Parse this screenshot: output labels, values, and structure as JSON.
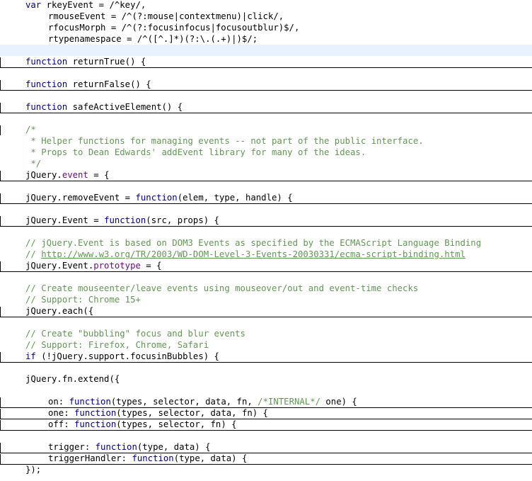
{
  "editor": {
    "language": "JavaScript",
    "lines": [
      {
        "indent": 0,
        "segments": [
          {
            "c": "kw",
            "t": "var "
          },
          {
            "c": "str",
            "t": "rkeyEvent = /^key/,"
          }
        ]
      },
      {
        "indent": 1,
        "segments": [
          {
            "c": "str",
            "t": "rmouseEvent = /^(?:mouse|contextmenu)|click/,"
          }
        ]
      },
      {
        "indent": 1,
        "segments": [
          {
            "c": "str",
            "t": "rfocusMorph = /^(?:focusinfocus|focusoutblur)$/,"
          }
        ]
      },
      {
        "indent": 1,
        "segments": [
          {
            "c": "str",
            "t": "rtypenamespace = /^([^.]*)(?:\\.(.+)|)$/;"
          }
        ]
      },
      {
        "indent": 0,
        "segments": [],
        "current": true
      },
      {
        "indent": 0,
        "fold": true,
        "separator": true,
        "segments": [
          {
            "c": "kw",
            "t": "function "
          },
          {
            "c": "plain",
            "t": "returnTrue() {"
          }
        ]
      },
      {
        "indent": 0,
        "segments": []
      },
      {
        "indent": 0,
        "fold": true,
        "separator": true,
        "segments": [
          {
            "c": "kw",
            "t": "function "
          },
          {
            "c": "plain",
            "t": "returnFalse() {"
          }
        ]
      },
      {
        "indent": 0,
        "segments": []
      },
      {
        "indent": 0,
        "fold": true,
        "separator": true,
        "segments": [
          {
            "c": "kw",
            "t": "function "
          },
          {
            "c": "plain",
            "t": "safeActiveElement() {"
          }
        ]
      },
      {
        "indent": 0,
        "segments": []
      },
      {
        "indent": 0,
        "fold": true,
        "segments": [
          {
            "c": "dc",
            "t": "/*"
          }
        ]
      },
      {
        "indent": 0,
        "segments": [
          {
            "c": "dc",
            "t": " * Helper functions for managing events -- not part of the public interface."
          }
        ]
      },
      {
        "indent": 0,
        "segments": [
          {
            "c": "dc",
            "t": " * Props to Dean Edwards' addEvent library for many of the ideas."
          }
        ]
      },
      {
        "indent": 0,
        "segments": [
          {
            "c": "dc",
            "t": " */"
          }
        ]
      },
      {
        "indent": 0,
        "fold": true,
        "separator": true,
        "segments": [
          {
            "c": "plain",
            "t": "jQuery."
          },
          {
            "c": "fld",
            "t": "event"
          },
          {
            "c": "plain",
            "t": " = {"
          }
        ]
      },
      {
        "indent": 0,
        "segments": []
      },
      {
        "indent": 0,
        "fold": true,
        "separator": true,
        "segments": [
          {
            "c": "plain",
            "t": "jQuery.removeEvent = "
          },
          {
            "c": "kw",
            "t": "function"
          },
          {
            "c": "plain",
            "t": "(elem, type, handle) {"
          }
        ]
      },
      {
        "indent": 0,
        "segments": []
      },
      {
        "indent": 0,
        "fold": true,
        "separator": true,
        "segments": [
          {
            "c": "plain",
            "t": "jQuery.Event = "
          },
          {
            "c": "kw",
            "t": "function"
          },
          {
            "c": "plain",
            "t": "(src, props) {"
          }
        ]
      },
      {
        "indent": 0,
        "segments": []
      },
      {
        "indent": 0,
        "segments": [
          {
            "c": "dc",
            "t": "// jQuery.Event is based on DOM3 Events as specified by the ECMAScript Language Binding"
          }
        ]
      },
      {
        "indent": 0,
        "segments": [
          {
            "c": "dc",
            "t": "// "
          },
          {
            "c": "ln",
            "t": "http://www.w3.org/TR/2003/WD-DOM-Level-3-Events-20030331/ecma-script-binding.html"
          }
        ]
      },
      {
        "indent": 0,
        "fold": true,
        "separator": true,
        "segments": [
          {
            "c": "plain",
            "t": "jQuery.Event."
          },
          {
            "c": "fld",
            "t": "prototype"
          },
          {
            "c": "plain",
            "t": " = {"
          }
        ]
      },
      {
        "indent": 0,
        "segments": []
      },
      {
        "indent": 0,
        "segments": [
          {
            "c": "dc",
            "t": "// Create mouseenter/leave events using mouseover/out and event-time checks"
          }
        ]
      },
      {
        "indent": 0,
        "segments": [
          {
            "c": "dc",
            "t": "// Support: Chrome 15+"
          }
        ]
      },
      {
        "indent": 0,
        "fold": true,
        "separator": true,
        "segments": [
          {
            "c": "plain",
            "t": "jQuery.each({"
          }
        ]
      },
      {
        "indent": 0,
        "segments": []
      },
      {
        "indent": 0,
        "segments": [
          {
            "c": "dc",
            "t": "// Create \"bubbling\" focus and blur events"
          }
        ]
      },
      {
        "indent": 0,
        "segments": [
          {
            "c": "dc",
            "t": "// Support: Firefox, Chrome, Safari"
          }
        ]
      },
      {
        "indent": 0,
        "fold": true,
        "separator": true,
        "segments": [
          {
            "c": "kw",
            "t": "if"
          },
          {
            "c": "plain",
            "t": " (!jQuery.support.focusinBubbles) {"
          }
        ]
      },
      {
        "indent": 0,
        "segments": []
      },
      {
        "indent": 0,
        "segments": [
          {
            "c": "plain",
            "t": "jQuery.fn.extend({"
          }
        ]
      },
      {
        "indent": 0,
        "segments": []
      },
      {
        "indent": 1,
        "fold": true,
        "separator": true,
        "segments": [
          {
            "c": "plain",
            "t": "on: "
          },
          {
            "c": "kw",
            "t": "function"
          },
          {
            "c": "plain",
            "t": "(types, selector, data, fn, "
          },
          {
            "c": "dc",
            "t": "/*INTERNAL*/"
          },
          {
            "c": "plain",
            "t": " one) {"
          }
        ]
      },
      {
        "indent": 1,
        "fold": true,
        "separator": true,
        "segments": [
          {
            "c": "plain",
            "t": "one: "
          },
          {
            "c": "kw",
            "t": "function"
          },
          {
            "c": "plain",
            "t": "(types, selector, data, fn) {"
          }
        ]
      },
      {
        "indent": 1,
        "fold": true,
        "separator": true,
        "segments": [
          {
            "c": "plain",
            "t": "off: "
          },
          {
            "c": "kw",
            "t": "function"
          },
          {
            "c": "plain",
            "t": "(types, selector, fn) {"
          }
        ]
      },
      {
        "indent": 0,
        "segments": []
      },
      {
        "indent": 1,
        "fold": true,
        "separator": true,
        "segments": [
          {
            "c": "plain",
            "t": "trigger: "
          },
          {
            "c": "kw",
            "t": "function"
          },
          {
            "c": "plain",
            "t": "(type, data) {"
          }
        ]
      },
      {
        "indent": 1,
        "fold": true,
        "separator": true,
        "segments": [
          {
            "c": "plain",
            "t": "triggerHandler: "
          },
          {
            "c": "kw",
            "t": "function"
          },
          {
            "c": "plain",
            "t": "(type, data) {"
          }
        ]
      },
      {
        "indent": 0,
        "segments": [
          {
            "c": "plain",
            "t": "});"
          }
        ]
      }
    ]
  },
  "colors": {
    "background": "#ffffff",
    "keyword": "#000080",
    "field": "#660e7a",
    "comment": "#629755",
    "current_line": "#e8f2fe",
    "separator": "#000000"
  }
}
